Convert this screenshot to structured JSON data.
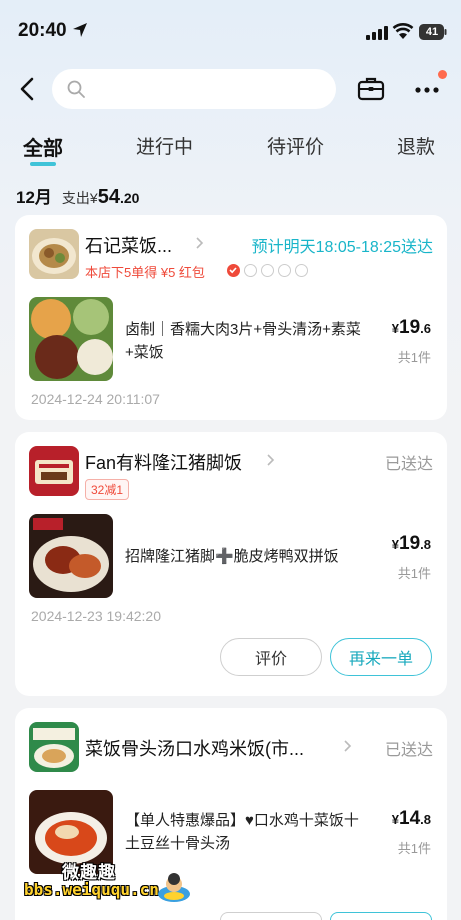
{
  "status_bar": {
    "time": "20:40",
    "battery": "41"
  },
  "search": {
    "placeholder": ""
  },
  "tabs": [
    {
      "label": "全部",
      "active": true
    },
    {
      "label": "进行中",
      "active": false
    },
    {
      "label": "待评价",
      "active": false
    },
    {
      "label": "退款",
      "active": false
    }
  ],
  "summary": {
    "month": "12月",
    "spend_label": "支出¥",
    "spend_int": "54",
    "spend_dec": ".20"
  },
  "orders": [
    {
      "shop": "石记菜饭...",
      "status": "预计明天18:05-18:25送达",
      "promo": "本店下5单得 ¥5 红包",
      "stamps_done": 1,
      "stamps_total": 5,
      "item": "卤制｜香糯大肉3片+骨头清汤+素菜+菜饭",
      "price_cur": "¥",
      "price_int": "19",
      "price_dec": ".6",
      "count": "共1件",
      "time": "2024-12-24 20:11:07"
    },
    {
      "shop": "Fan有料隆江猪脚饭",
      "status": "已送达",
      "coupon": "32减1",
      "item": "招牌隆江猪脚➕脆皮烤鸭双拼饭",
      "price_cur": "¥",
      "price_int": "19",
      "price_dec": ".8",
      "count": "共1件",
      "time": "2024-12-23 19:42:20",
      "btn_review": "评价",
      "btn_reorder": "再来一单"
    },
    {
      "shop": "菜饭骨头汤口水鸡米饭(市...",
      "status": "已送达",
      "item": "【单人特惠爆品】♥口水鸡十菜饭十土豆丝十骨头汤",
      "price_cur": "¥",
      "price_int": "14",
      "price_dec": ".8",
      "count": "共1件"
    }
  ],
  "watermark": {
    "line1": "微趣趣",
    "line2": "bbs.weiququ.cn"
  },
  "colors": {
    "accent": "#3fc3d8",
    "promo_red": "#ef4a3a",
    "status_teal": "#19b5c9"
  }
}
